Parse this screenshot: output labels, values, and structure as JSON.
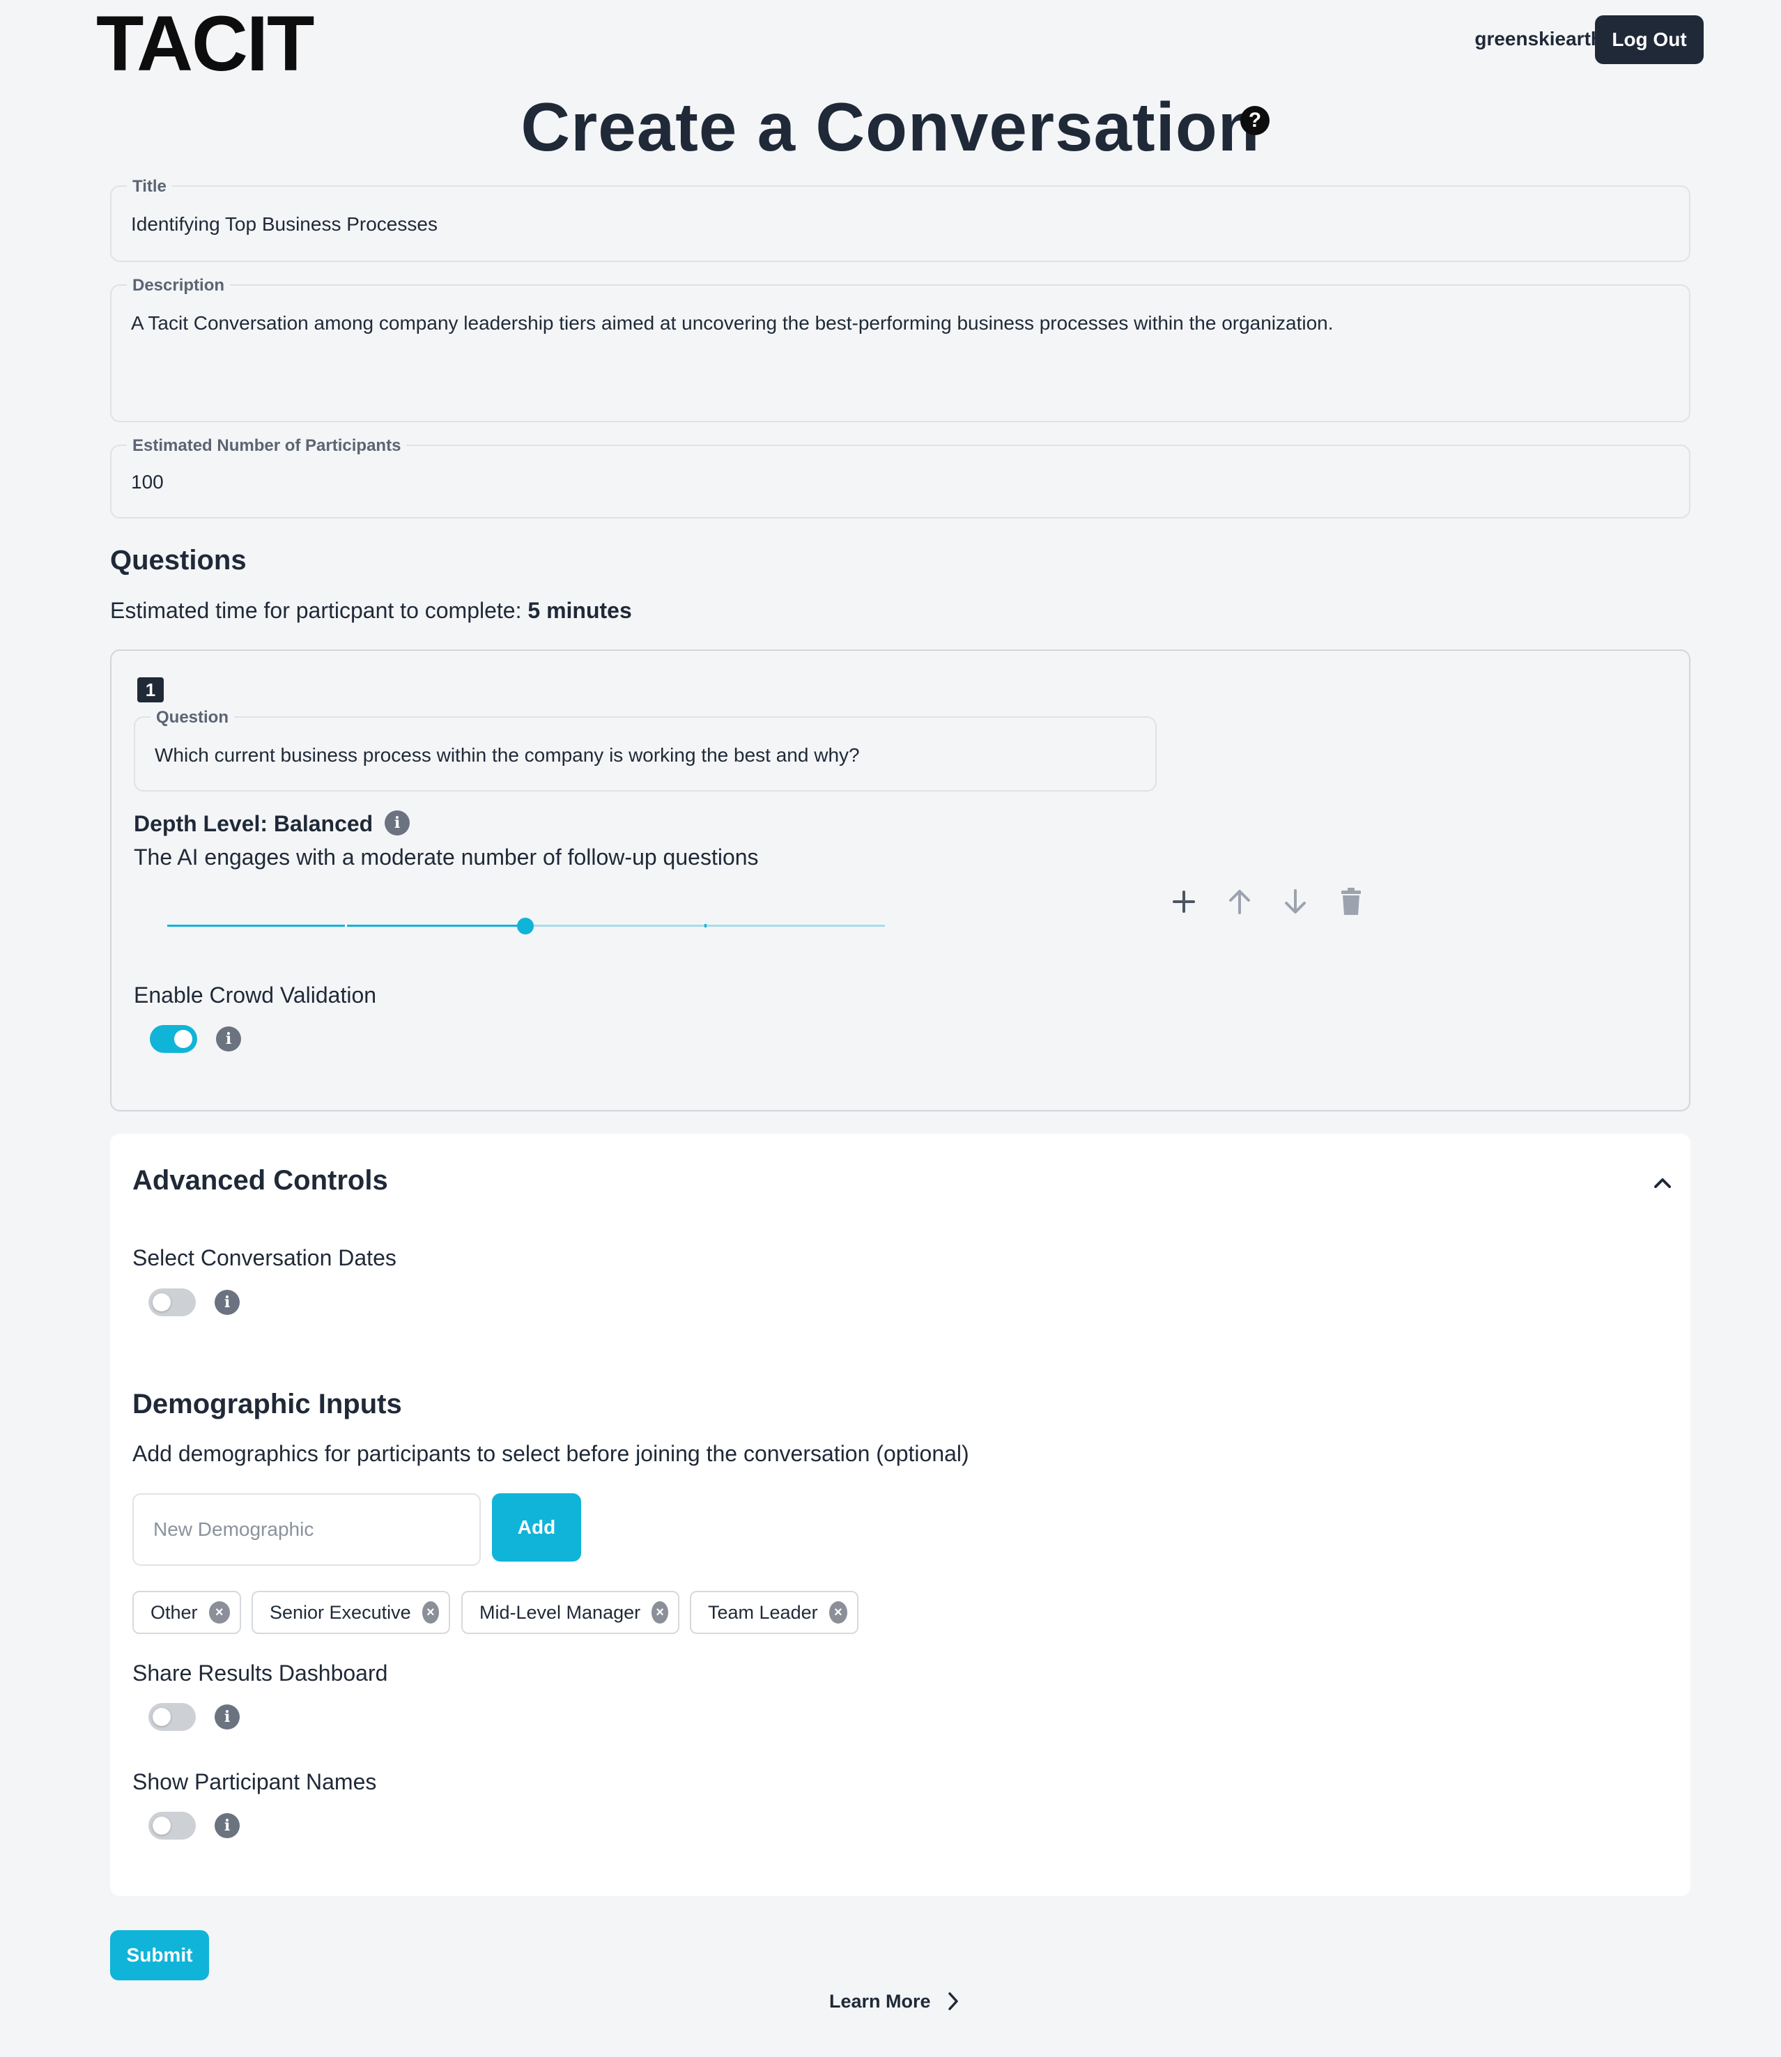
{
  "header": {
    "logo": "TACIT",
    "username": "greenskiearth",
    "logout_label": "Log Out"
  },
  "page": {
    "title": "Create a Conversation",
    "help_icon": "question-circle-icon"
  },
  "form": {
    "title": {
      "label": "Title",
      "value": "Identifying Top Business Processes"
    },
    "description": {
      "label": "Description",
      "value": "A Tacit Conversation among company leadership tiers aimed at uncovering the best-performing business processes within the organization."
    },
    "participants": {
      "label": "Estimated Number of Participants",
      "value": "100"
    }
  },
  "questions": {
    "heading": "Questions",
    "estimate_prefix": "Estimated time for particpant to complete: ",
    "estimate_value": "5 minutes",
    "items": [
      {
        "number": "1",
        "question_label": "Question",
        "question_value": "Which current business process within the company is working the best and why?",
        "depth_label": "Depth Level: Balanced",
        "depth_description": "The AI engages with a moderate number of follow-up questions",
        "depth_slider": {
          "steps": 5,
          "selected_index": 2
        },
        "crowd_validation_label": "Enable Crowd Validation",
        "crowd_validation_enabled": true,
        "actions": [
          "plus-icon",
          "arrow-up-icon",
          "arrow-down-icon",
          "trash-icon"
        ]
      }
    ]
  },
  "advanced": {
    "heading": "Advanced Controls",
    "collapse_icon": "chevron-up-icon",
    "dates_label": "Select Conversation Dates",
    "dates_enabled": false,
    "demographics": {
      "heading": "Demographic Inputs",
      "description": "Add demographics for participants to select before joining the conversation (optional)",
      "input_placeholder": "New Demographic",
      "add_label": "Add",
      "chips": [
        "Other",
        "Senior Executive",
        "Mid-Level Manager",
        "Team Leader"
      ]
    },
    "share_dashboard_label": "Share Results Dashboard",
    "share_dashboard_enabled": false,
    "show_names_label": "Show Participant Names",
    "show_names_enabled": false
  },
  "footer": {
    "submit_label": "Submit",
    "learn_more_label": "Learn More"
  },
  "colors": {
    "accent": "#10b4d8",
    "dark": "#1f2937",
    "background": "#f4f5f7"
  }
}
